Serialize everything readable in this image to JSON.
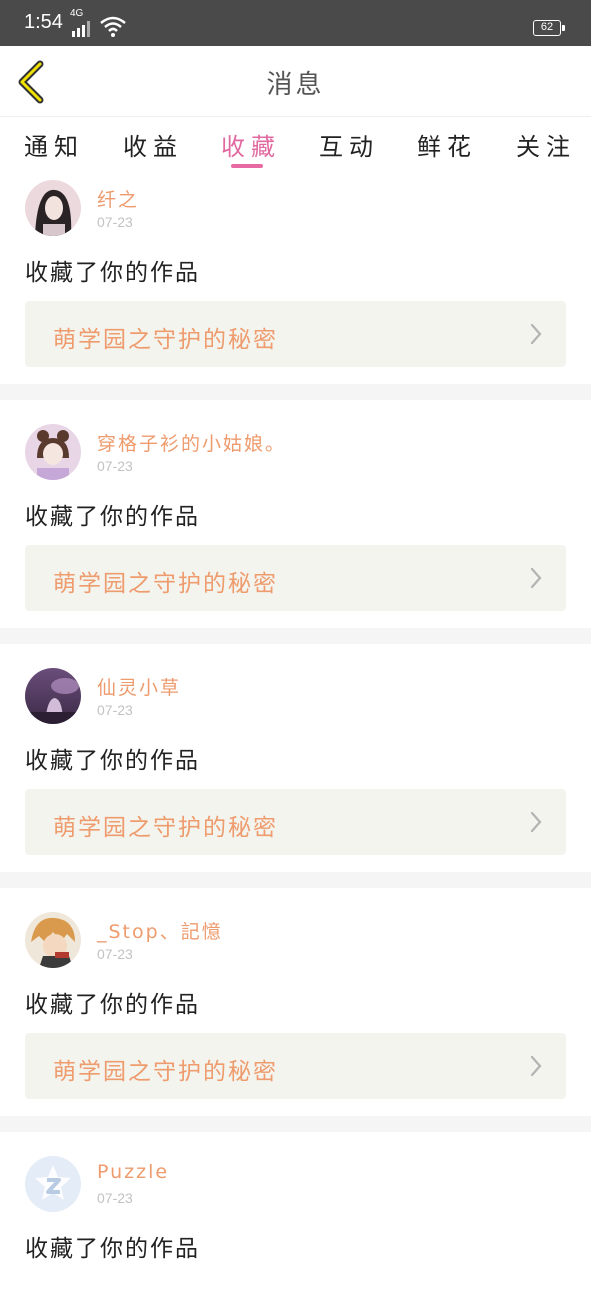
{
  "status_bar": {
    "time": "1:54",
    "network": "4G",
    "battery": "62"
  },
  "header": {
    "title": "消息"
  },
  "tabs": [
    {
      "label": "通知"
    },
    {
      "label": "收益"
    },
    {
      "label": "收藏",
      "active": true
    },
    {
      "label": "互动"
    },
    {
      "label": "鲜花"
    },
    {
      "label": "关注"
    }
  ],
  "notifications": [
    {
      "username": "纤之",
      "date": "07-23",
      "action": "收藏了你的作品",
      "work_title": "萌学园之守护的秘密"
    },
    {
      "username": "穿格子衫的小姑娘。",
      "date": "07-23",
      "action": "收藏了你的作品",
      "work_title": "萌学园之守护的秘密"
    },
    {
      "username": "仙灵小草",
      "date": "07-23",
      "action": "收藏了你的作品",
      "work_title": "萌学园之守护的秘密"
    },
    {
      "username": "_Stop、記憶",
      "date": "07-23",
      "action": "收藏了你的作品",
      "work_title": "萌学园之守护的秘密"
    },
    {
      "username": "Puzzle",
      "date": "07-23",
      "action": "收藏了你的作品"
    }
  ],
  "icons": {
    "back": "chevron-left-icon",
    "work_link": "chevron-right-icon"
  },
  "colors": {
    "accent": "#e86aa3",
    "username": "#ee9b6d",
    "work_bg": "#f4f4ee",
    "status_bar": "#4a4a4a"
  }
}
